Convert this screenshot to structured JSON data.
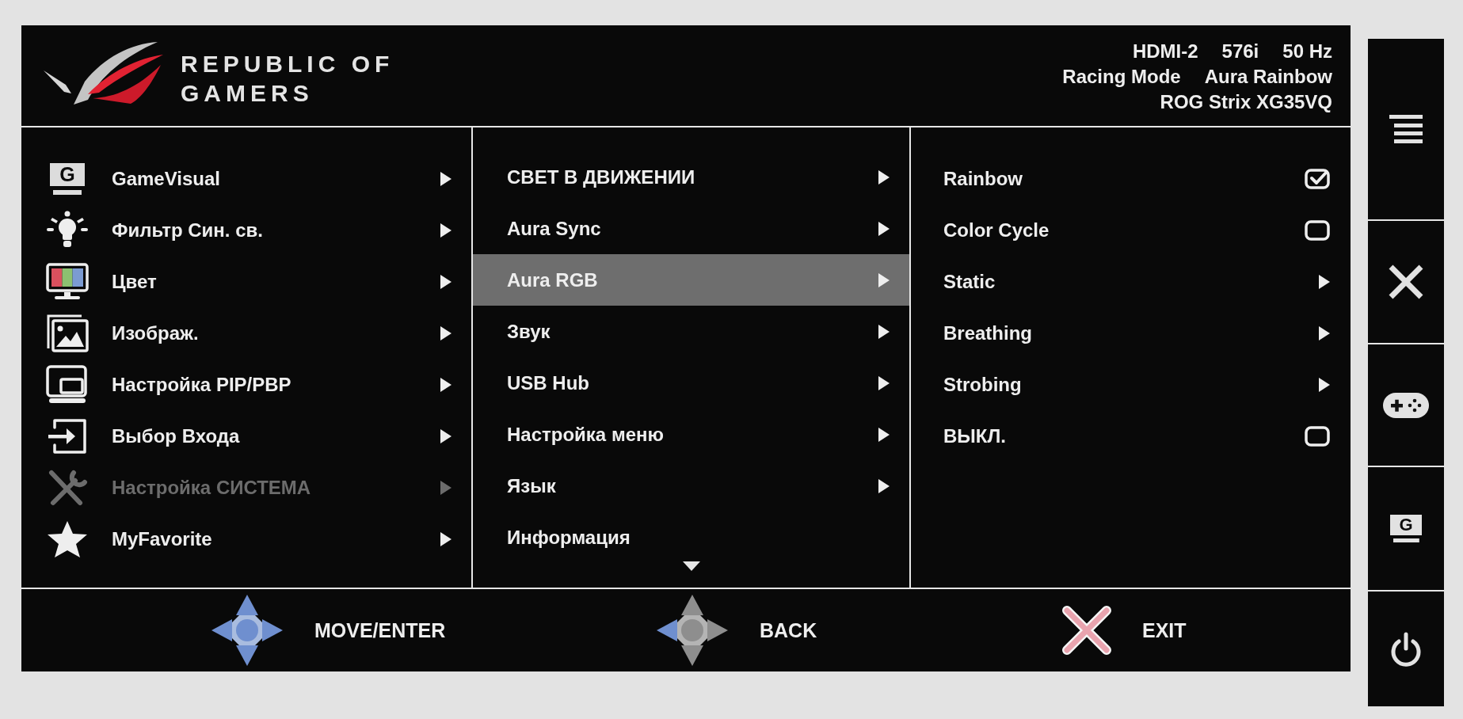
{
  "header": {
    "logo_text": "REPUBLIC OF GAMERS",
    "input": "HDMI-2",
    "resolution": "576i",
    "refresh_rate": "50 Hz",
    "mode": "Racing Mode",
    "lighting": "Aura Rainbow",
    "model": "ROG Strix XG35VQ"
  },
  "main_menu": {
    "items": [
      {
        "kind": "gamevisual",
        "glyph": "G",
        "label": "GameVisual",
        "dimmed": false
      },
      {
        "kind": "bluelight",
        "label": "Фильтр Син. св.",
        "dimmed": false
      },
      {
        "kind": "color",
        "label": "Цвет",
        "dimmed": false
      },
      {
        "kind": "image",
        "label": "Изображ.",
        "dimmed": false
      },
      {
        "kind": "pip",
        "label": "Настройка PIP/PBP",
        "dimmed": false
      },
      {
        "kind": "input",
        "label": "Выбор Входа",
        "dimmed": false
      },
      {
        "kind": "system",
        "label": "Настройка СИСТЕМА",
        "dimmed": true
      },
      {
        "kind": "favorite",
        "label": "MyFavorite",
        "dimmed": false
      }
    ]
  },
  "submenu": {
    "more_below": true,
    "items": [
      {
        "kind": "submenu",
        "label": "СВЕТ В ДВИЖЕНИИ",
        "selected": false
      },
      {
        "kind": "submenu",
        "label": "Aura Sync",
        "selected": false
      },
      {
        "kind": "submenu",
        "label": "Aura RGB",
        "selected": true
      },
      {
        "kind": "submenu",
        "label": "Звук",
        "selected": false
      },
      {
        "kind": "submenu",
        "label": "USB Hub",
        "selected": false
      },
      {
        "kind": "submenu",
        "label": "Настройка меню",
        "selected": false
      },
      {
        "kind": "submenu",
        "label": "Язык",
        "selected": false
      },
      {
        "kind": "item",
        "label": "Информация",
        "selected": false
      }
    ]
  },
  "options": {
    "items": [
      {
        "kind": "checkbox",
        "label": "Rainbow",
        "checked": true
      },
      {
        "kind": "checkbox",
        "label": "Color Cycle",
        "checked": false
      },
      {
        "kind": "submenu",
        "label": "Static"
      },
      {
        "kind": "submenu",
        "label": "Breathing"
      },
      {
        "kind": "submenu",
        "label": "Strobing"
      },
      {
        "kind": "checkbox",
        "label": "ВЫКЛ.",
        "checked": false
      }
    ]
  },
  "hints": [
    {
      "kind": "dpad",
      "label": "MOVE/ENTER"
    },
    {
      "kind": "dpadleft",
      "label": "BACK"
    },
    {
      "kind": "cross",
      "label": "EXIT"
    }
  ],
  "side_buttons": [
    {
      "kind": "menu"
    },
    {
      "kind": "close"
    },
    {
      "kind": "gamepad"
    },
    {
      "kind": "glyph",
      "glyph": "G"
    },
    {
      "kind": "power"
    }
  ]
}
